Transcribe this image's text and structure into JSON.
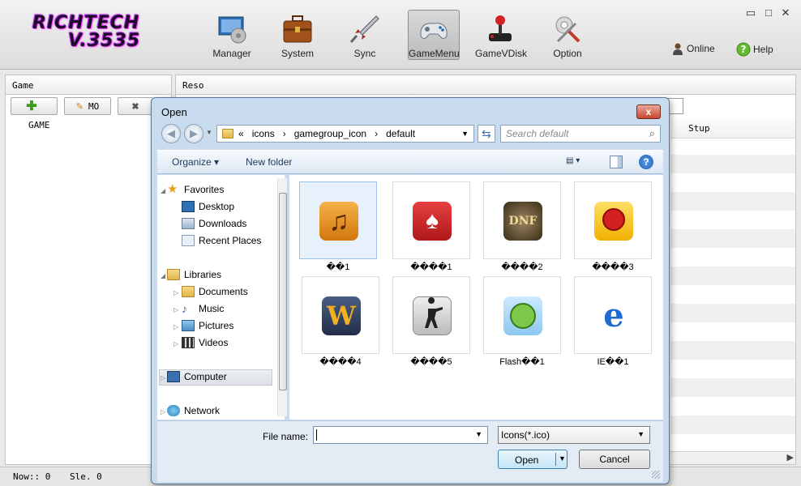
{
  "app": {
    "logo_line1": "RICHTECH",
    "logo_line2": "V.3535",
    "toolbar": [
      {
        "label": "Manager",
        "icon": "manager-icon"
      },
      {
        "label": "System",
        "icon": "briefcase-icon"
      },
      {
        "label": "Sync",
        "icon": "rocket-icon"
      },
      {
        "label": "GameMenu",
        "icon": "gamepad-icon",
        "active": true
      },
      {
        "label": "GameVDisk",
        "icon": "joystick-icon"
      },
      {
        "label": "Option",
        "icon": "settings-tools-icon"
      }
    ],
    "online_label": "Online",
    "help_label": "Help",
    "window_controls": {
      "minimize": "▭",
      "maximize": "□",
      "close": "✕"
    }
  },
  "left_panel": {
    "header": "Game",
    "add_label": "",
    "mo_label": "MO",
    "tree_item": "GAME"
  },
  "right_panel": {
    "header": "Reso",
    "col_stup": "Stup"
  },
  "status": {
    "now": "Now:: 0",
    "sle": "Sle. 0"
  },
  "dialog": {
    "title": "Open",
    "close": "x",
    "breadcrumb": [
      "«",
      "icons",
      "gamegroup_icon",
      "default"
    ],
    "search_placeholder": "Search default",
    "organize_label": "Organize ▾",
    "new_folder_label": "New folder",
    "help_glyph": "?",
    "nav": {
      "favorites": "Favorites",
      "desktop": "Desktop",
      "downloads": "Downloads",
      "recent": "Recent Places",
      "libraries": "Libraries",
      "documents": "Documents",
      "music": "Music",
      "pictures": "Pictures",
      "videos": "Videos",
      "computer": "Computer",
      "network": "Network"
    },
    "files": [
      {
        "caption": "��1",
        "icon": "music-note-icon",
        "color": "#e8901c",
        "selected": true
      },
      {
        "caption": "����1",
        "icon": "playing-cards-icon",
        "color": "#d2262a"
      },
      {
        "caption": "����2",
        "icon": "dnf-icon",
        "color": "#6a5a3a"
      },
      {
        "caption": "����3",
        "icon": "racer-icon",
        "color": "#f2c21a"
      },
      {
        "caption": "����4",
        "icon": "warcraft-icon",
        "color": "#3a4a6a"
      },
      {
        "caption": "����5",
        "icon": "counter-strike-icon",
        "color": "#d8d8d8"
      },
      {
        "caption": "Flash��1",
        "icon": "bubble-dragon-icon",
        "color": "#8fcf5a"
      },
      {
        "caption": "IE��1",
        "icon": "internet-explorer-icon",
        "color": "#dfe9f5"
      }
    ],
    "file_name_label": "File name:",
    "file_name_value": "",
    "filter_value": "Icons(*.ico)",
    "open_label": "Open",
    "cancel_label": "Cancel"
  }
}
